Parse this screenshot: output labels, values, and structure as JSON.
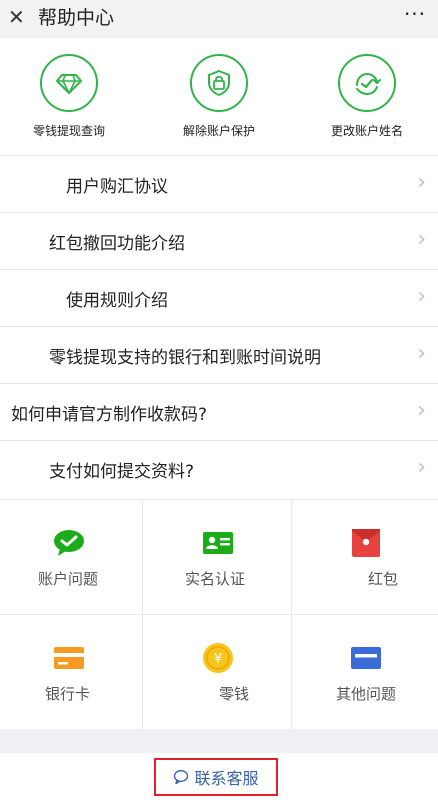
{
  "header": {
    "close_glyph": "✕",
    "title": "帮助中心",
    "more_glyph": "···"
  },
  "shortcuts": [
    {
      "label": "零钱提现查询",
      "icon": "diamond-icon"
    },
    {
      "label": "解除账户保护",
      "icon": "lock-icon"
    },
    {
      "label": "更改账户姓名",
      "icon": "refresh-check-icon"
    }
  ],
  "list_items": [
    {
      "label": "用户购汇协议"
    },
    {
      "label": "红包撤回功能介绍"
    },
    {
      "label": "使用规则介绍"
    },
    {
      "label": "零钱提现支持的银行和到账时间说明"
    },
    {
      "label": "如何申请官方制作收款码?"
    },
    {
      "label": "支付如何提交资料?"
    }
  ],
  "chevron_glyph": "›",
  "categories": [
    {
      "label": "账户问题",
      "icon": "checkmark-bubble-icon",
      "color": "#1aad19"
    },
    {
      "label": "实名认证",
      "icon": "id-card-icon",
      "color": "#1aad19"
    },
    {
      "label": "红包",
      "icon": "red-packet-icon",
      "color": "#e64340"
    },
    {
      "label": "银行卡",
      "icon": "bank-card-icon",
      "color": "#f59a23"
    },
    {
      "label": "零钱",
      "icon": "coin-icon",
      "color": "#f7c51e"
    },
    {
      "label": "其他问题",
      "icon": "other-card-icon",
      "color": "#3b6bd6"
    }
  ],
  "footer": {
    "contact_label": "联系客服",
    "contact_icon": "chat-bubble-icon",
    "accent": "#3a62a7",
    "highlight": "#e0202a"
  }
}
